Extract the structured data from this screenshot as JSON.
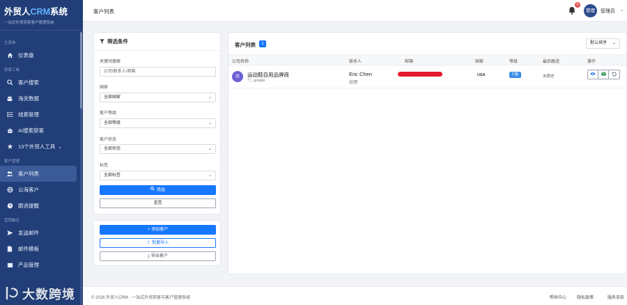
{
  "brand": {
    "name_prefix": "外贸人",
    "name_crm": "CRM",
    "name_suffix": "系统",
    "subtitle": "一站式外贸获客客户管理系统"
  },
  "sidebar": {
    "sections": [
      {
        "label": "主菜单",
        "items": [
          {
            "label": "仪表盘",
            "icon": "home-icon"
          }
        ]
      },
      {
        "label": "获客工具",
        "items": [
          {
            "label": "客户搜索",
            "icon": "search-icon"
          },
          {
            "label": "海关数据",
            "icon": "ship-icon"
          },
          {
            "label": "线索管理",
            "icon": "list-icon"
          },
          {
            "label": "AI搜索获客",
            "icon": "robot-icon"
          },
          {
            "label": "13个外贸人工具",
            "icon": "tools-icon",
            "caret": "⌄"
          }
        ]
      },
      {
        "label": "客户管理",
        "items": [
          {
            "label": "客户列表",
            "icon": "users-icon",
            "active": true
          },
          {
            "label": "公海客户",
            "icon": "globe-icon"
          },
          {
            "label": "跟进提醒",
            "icon": "clock-icon"
          }
        ]
      },
      {
        "label": "营销触达",
        "items": [
          {
            "label": "发送邮件",
            "icon": "mail-icon"
          },
          {
            "label": "邮件模板",
            "icon": "file-icon"
          },
          {
            "label": "产品管理",
            "icon": "box-icon"
          }
        ]
      }
    ]
  },
  "header": {
    "title": "客户列表",
    "notification_count": "8",
    "avatar_text": "管理",
    "user_name": "管理员"
  },
  "filters": {
    "title": "筛选条件",
    "keyword": {
      "label": "关键词搜索",
      "placeholder": "公司/联系人/邮箱"
    },
    "country": {
      "label": "国家",
      "value": "全部国家"
    },
    "grade": {
      "label": "客户等级",
      "value": "全部等级"
    },
    "status": {
      "label": "客户状态",
      "value": "全部状态"
    },
    "tag": {
      "label": "标签",
      "value": "全部标签"
    },
    "filter_button": "筛选",
    "reset_button": "重置"
  },
  "actions": {
    "add": "添加客户",
    "import": "批量导入",
    "export": "导出客户"
  },
  "list": {
    "title": "客户列表",
    "count": "1",
    "sort": "默认排序",
    "columns": [
      "公司名称",
      "联系人",
      "邮箱",
      "国家",
      "等级",
      "最后跟进",
      "操作"
    ],
    "rows": [
      {
        "avatar": "运",
        "company": "运动鞋自用品牌商",
        "tag": "google",
        "contact": "Eric Chen",
        "role": "经理",
        "email": "[redacted]",
        "country": "USA",
        "grade": "C级",
        "last_followup": "未跟进"
      }
    ]
  },
  "footer": {
    "copyright": "© 2026 外贸人CRM - 一站式外贸获客与客户管理系统",
    "links": [
      "帮助中心",
      "隐私政策",
      "服务条款"
    ]
  },
  "watermark": {
    "text": "大数跨境"
  },
  "colors": {
    "sidebar": "#213e78",
    "primary": "#1677ff",
    "badge": "#e34d4d",
    "redaction": "#e5192c"
  }
}
